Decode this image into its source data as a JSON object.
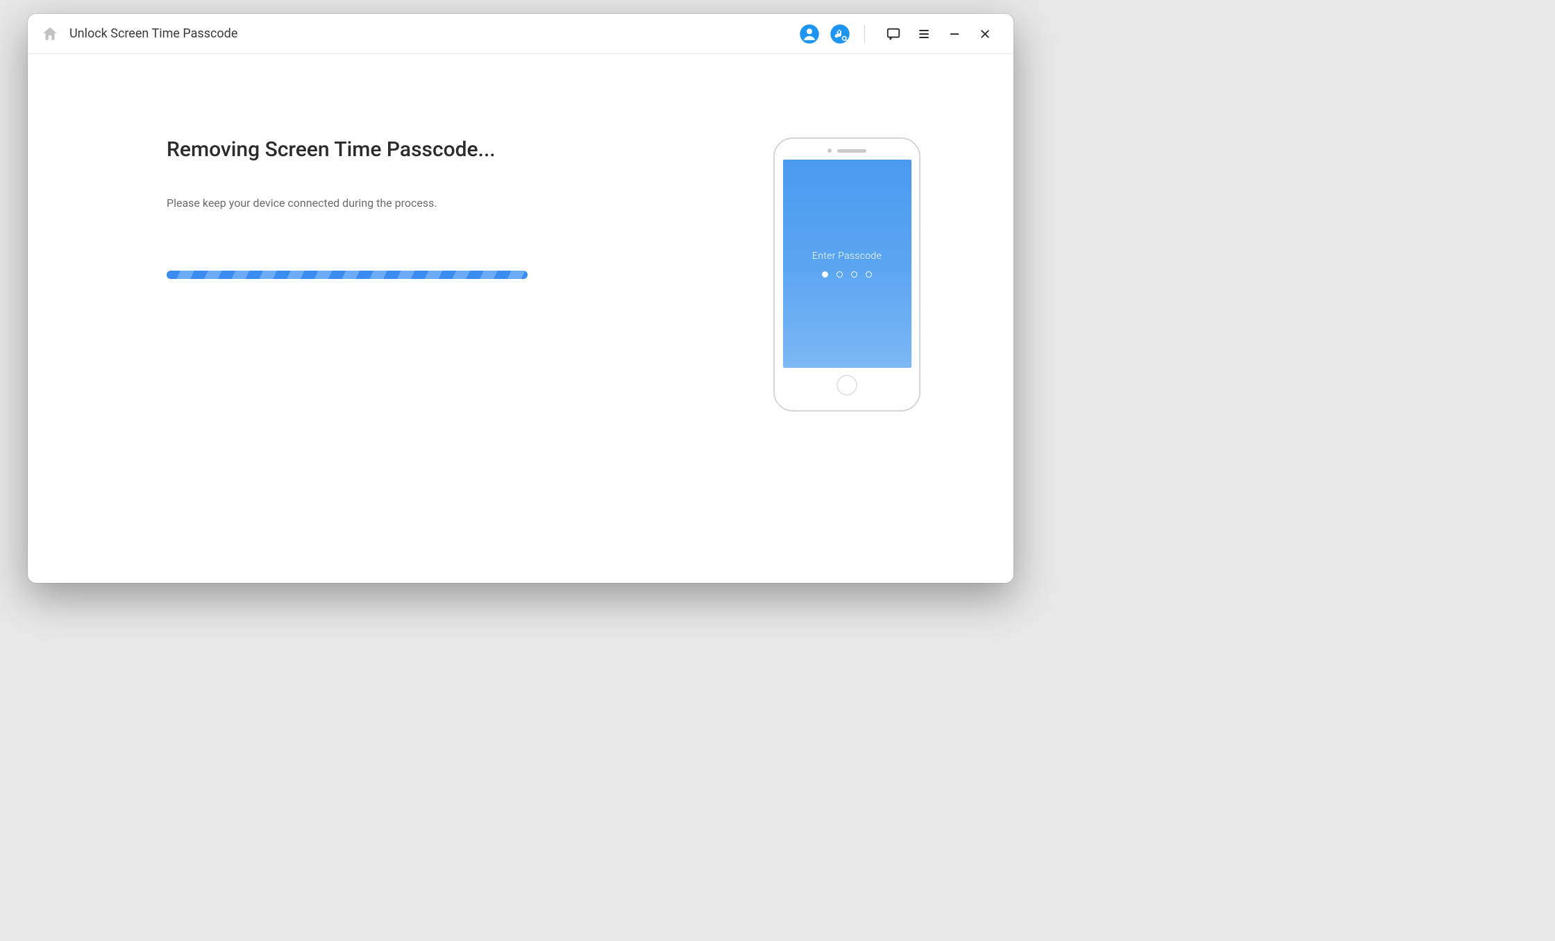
{
  "titlebar": {
    "title": "Unlock Screen Time Passcode"
  },
  "main": {
    "heading": "Removing Screen Time Passcode...",
    "subtext": "Please keep your device connected during the process.",
    "progress_percent": 100
  },
  "phone": {
    "screen_label": "Enter Passcode",
    "passcode_dots_total": 4,
    "passcode_dots_filled": 1
  },
  "colors": {
    "accent": "#1e95f3",
    "progress_start": "#3b8cf0",
    "progress_stripe": "#6cacf5"
  }
}
